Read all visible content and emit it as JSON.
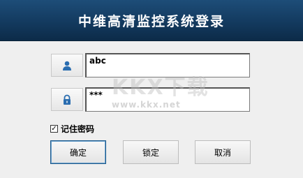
{
  "window": {
    "title": "中维高清监控系统登录"
  },
  "form": {
    "username_value": "abc",
    "password_value": "***",
    "username_icon": "user-icon",
    "password_icon": "lock-icon"
  },
  "remember": {
    "label": "记住密码",
    "checked": true
  },
  "buttons": {
    "confirm": "确定",
    "lock": "锁定",
    "cancel": "取消"
  },
  "watermark": {
    "logo": "KKX下载",
    "url": "www.kkx.net"
  },
  "colors": {
    "title_bar": "#133a5f",
    "icon_blue": "#2a6db0",
    "background": "#efefef"
  }
}
